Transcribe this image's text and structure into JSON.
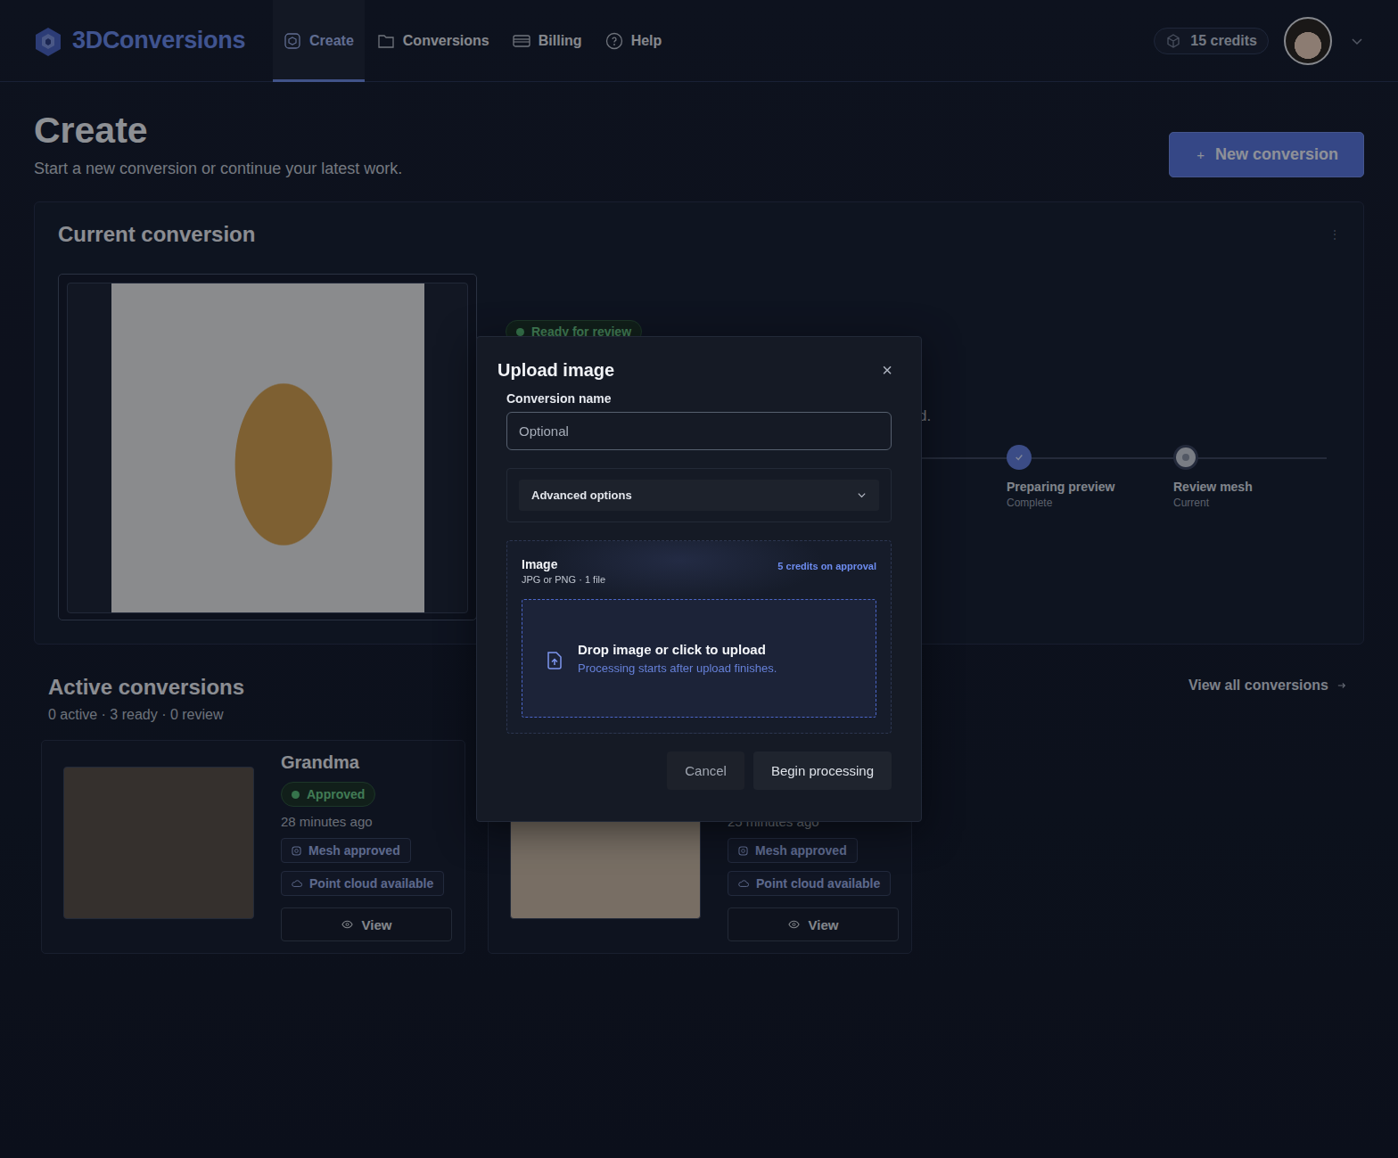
{
  "app": {
    "name": "3DConversions"
  },
  "nav": [
    {
      "label": "Create",
      "selected": true,
      "icon": "cube"
    },
    {
      "label": "Conversions",
      "selected": false,
      "icon": "folder"
    },
    {
      "label": "Billing",
      "selected": false,
      "icon": "card"
    },
    {
      "label": "Help",
      "selected": false,
      "icon": "help"
    }
  ],
  "credits": "15 credits",
  "page": {
    "title": "Create",
    "subtitle": "Start a new conversion or continue your latest work.",
    "new_button": "New conversion",
    "new_button_icon": "+"
  },
  "current": {
    "title": "Current conversion",
    "menu_icon": "⋮",
    "status": "Ready for review",
    "description_tail": "d.",
    "steps": [
      {
        "label": "Preparing preview",
        "sub": "Complete",
        "state": "complete"
      },
      {
        "label": "Review mesh",
        "sub": "Current",
        "state": "current"
      }
    ]
  },
  "active": {
    "title": "Active conversions",
    "summary": "0 active · 3 ready · 0 review",
    "view_all": "View all conversions",
    "cards": [
      {
        "name": "Grandma",
        "status": "Approved",
        "time": "28 minutes ago",
        "chips": [
          "Mesh approved",
          "Point cloud available"
        ],
        "action": "View",
        "photo": "#5b5048"
      },
      {
        "time": "25 minutes ago",
        "chips": [
          "Mesh approved",
          "Point cloud available"
        ],
        "action": "View",
        "photo": "#cdbba6"
      }
    ]
  },
  "modal": {
    "title": "Upload image",
    "close": "×",
    "name_label": "Conversion name",
    "name_placeholder": "Optional",
    "advanced": {
      "label": "Advanced options",
      "expanded": false
    },
    "image": {
      "label": "Image",
      "hint": "JPG or PNG · 1 file",
      "cost": "5 credits on approval",
      "drop_title": "Drop image or click to upload",
      "drop_hint": "Processing starts after upload finishes."
    },
    "buttons": [
      {
        "label": "Cancel",
        "kind": "secondary"
      },
      {
        "label": "Begin processing",
        "kind": "primary"
      }
    ]
  }
}
